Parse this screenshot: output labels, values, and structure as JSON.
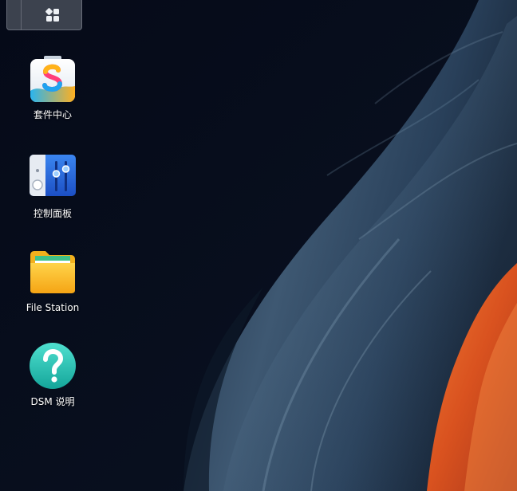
{
  "taskbar": {
    "menu_icon": "main-menu-grid-icon"
  },
  "desktop_icons": [
    {
      "label": "套件中心",
      "icon": "package-center-icon"
    },
    {
      "label": "控制面板",
      "icon": "control-panel-icon"
    },
    {
      "label": "File Station",
      "icon": "file-station-folder-icon"
    },
    {
      "label": "DSM 说明",
      "icon": "dsm-help-icon"
    }
  ],
  "colors": {
    "desktop_background": "#060b1a",
    "rock_blue": "#4a6680",
    "canyon_orange": "#e0602a",
    "help_teal": "#2dc3b4",
    "control_panel_blue": "#2a66d8",
    "folder_yellow": "#f9b81e"
  }
}
